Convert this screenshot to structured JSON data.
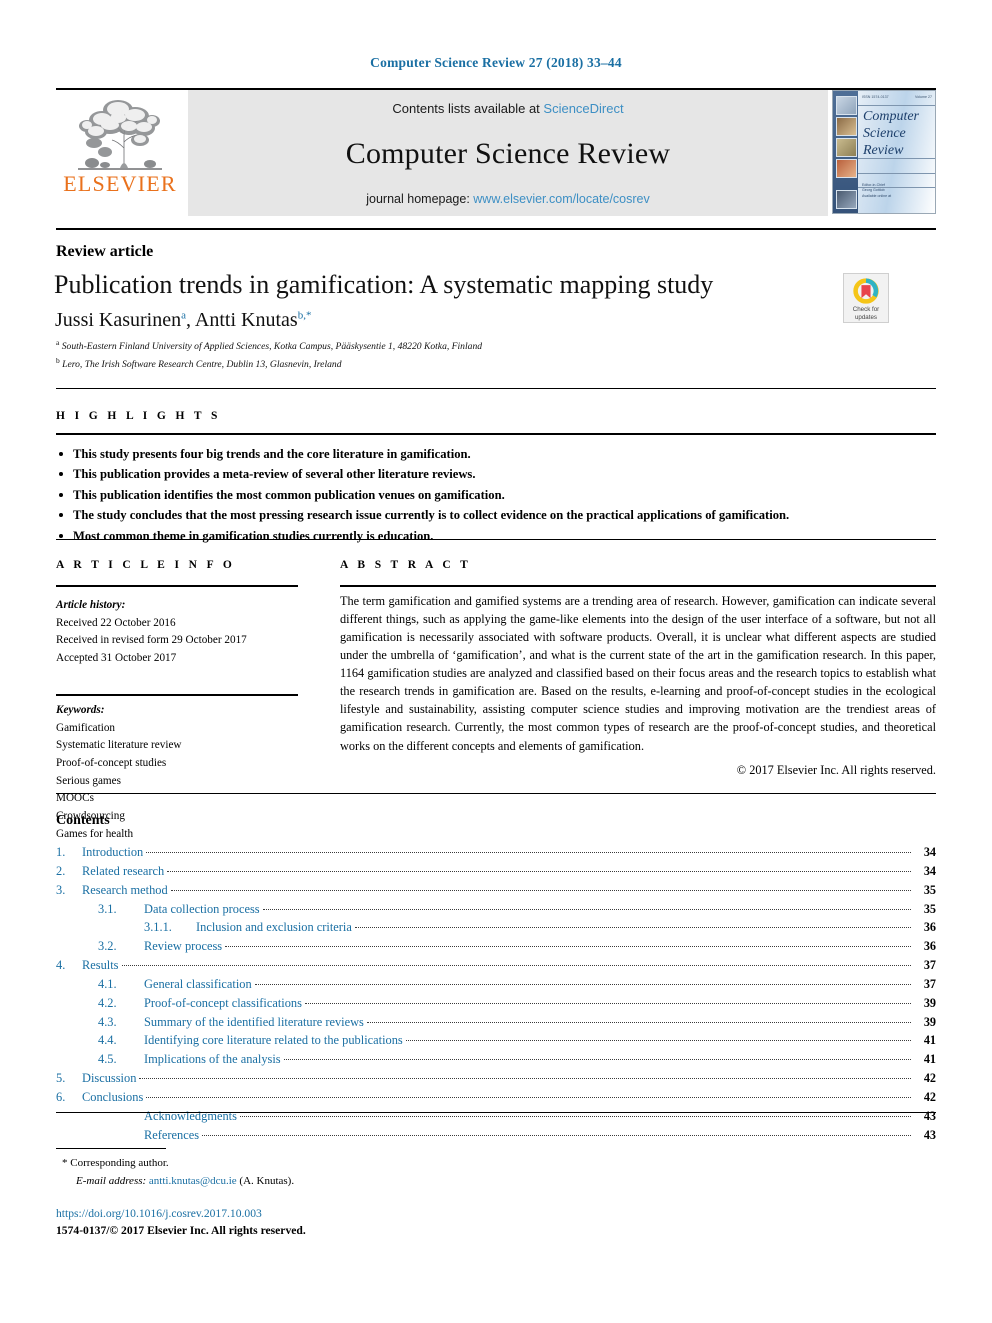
{
  "running_head": "Computer Science Review 27 (2018) 33–44",
  "masthead": {
    "publisher_name": "ELSEVIER",
    "contents_prefix": "Contents lists available at ",
    "contents_link": "ScienceDirect",
    "journal_title": "Computer Science Review",
    "homepage_prefix": "journal homepage: ",
    "homepage_link": "www.elsevier.com/locate/cosrev",
    "cover": {
      "title_line1": "Computer",
      "title_line2": "Science",
      "title_line3": "Review",
      "top_left": "ISSN 1574-0137",
      "top_right": "Volume 27",
      "foot_line1": "Editor-in-Chief",
      "foot_line2": "Georg Gottlob",
      "foot_line3": "Available online at"
    }
  },
  "article": {
    "type": "Review article",
    "title": "Publication trends in gamification: A systematic mapping study",
    "authors": [
      {
        "name": "Jussi Kasurinen",
        "mark": "a"
      },
      {
        "name": "Antti Knutas",
        "mark": "b,"
      }
    ],
    "affiliations": [
      {
        "mark": "a",
        "text": "South-Eastern Finland University of Applied Sciences, Kotka Campus, Pääskysentie 1, 48220 Kotka, Finland"
      },
      {
        "mark": "b",
        "text": "Lero, The Irish Software Research Centre, Dublin 13, Glasnevin, Ireland"
      }
    ],
    "crossmark": {
      "line1": "Check for",
      "line2": "updates"
    }
  },
  "highlights": {
    "label": "H I G H L I G H T S",
    "items": [
      "This study presents four big trends and the core literature in gamification.",
      "This publication provides a meta-review of several other literature reviews.",
      "This publication identifies the most common publication venues on gamification.",
      "The study concludes that the most pressing research issue currently is to collect evidence on the practical applications of gamification.",
      "Most common theme in gamification studies currently is education."
    ]
  },
  "article_info": {
    "label": "A R T I C L E   I N F O",
    "history_head": "Article history:",
    "history": [
      "Received 22 October 2016",
      "Received in revised form 29 October 2017",
      "Accepted 31 October 2017"
    ],
    "keywords_head": "Keywords:",
    "keywords": [
      "Gamification",
      "Systematic literature review",
      "Proof-of-concept studies",
      "Serious games",
      "MOOCs",
      "Crowdsourcing",
      "Games for health"
    ]
  },
  "abstract": {
    "label": "A B S T R A C T",
    "text": "The term gamification and gamified systems are a trending area of research. However, gamification can indicate several different things, such as applying the game-like elements into the design of the user interface of a software, but not all gamification is necessarily associated with software products. Overall, it is unclear what different aspects are studied under the umbrella of ‘gamification’, and what is the current state of the art in the gamification research. In this paper, 1164 gamification studies are analyzed and classified based on their focus areas and the research topics to establish what the research trends in gamification are. Based on the results, e-learning and proof-of-concept studies in the ecological lifestyle and sustainability, assisting computer science studies and improving motivation are the trendiest areas of gamification research. Currently, the most common types of research are the proof-of-concept studies, and theoretical works on the different concepts and elements of gamification.",
    "copyright": "© 2017 Elsevier Inc. All rights reserved."
  },
  "contents": {
    "heading": "Contents",
    "entries": [
      {
        "level": 1,
        "num": "1.",
        "label": "Introduction",
        "page": "34"
      },
      {
        "level": 1,
        "num": "2.",
        "label": "Related research",
        "page": "34"
      },
      {
        "level": 1,
        "num": "3.",
        "label": "Research method",
        "page": "35"
      },
      {
        "level": 2,
        "num": "3.1.",
        "label": "Data collection process",
        "page": "35"
      },
      {
        "level": 3,
        "num": "3.1.1.",
        "label": "Inclusion and exclusion criteria",
        "page": "36"
      },
      {
        "level": 2,
        "num": "3.2.",
        "label": "Review process",
        "page": "36"
      },
      {
        "level": 1,
        "num": "4.",
        "label": "Results",
        "page": "37"
      },
      {
        "level": 2,
        "num": "4.1.",
        "label": "General classification",
        "page": "37"
      },
      {
        "level": 2,
        "num": "4.2.",
        "label": "Proof-of-concept classifications",
        "page": "39"
      },
      {
        "level": 2,
        "num": "4.3.",
        "label": "Summary of the identified literature reviews",
        "page": "39"
      },
      {
        "level": 2,
        "num": "4.4.",
        "label": "Identifying core literature related to the publications",
        "page": "41"
      },
      {
        "level": 2,
        "num": "4.5.",
        "label": "Implications of the analysis",
        "page": "41"
      },
      {
        "level": 1,
        "num": "5.",
        "label": "Discussion",
        "page": "42"
      },
      {
        "level": 1,
        "num": "6.",
        "label": "Conclusions",
        "page": "42"
      },
      {
        "level": 2,
        "num": "",
        "label": "Acknowledgments",
        "page": "43"
      },
      {
        "level": 2,
        "num": "",
        "label": "References",
        "page": "43"
      }
    ]
  },
  "footer": {
    "corresponding_mark": "*",
    "corresponding_text": "Corresponding author.",
    "email_label": "E-mail address:",
    "email": "antti.knutas@dcu.ie",
    "email_suffix": "(A. Knutas).",
    "doi": "https://doi.org/10.1016/j.cosrev.2017.10.003",
    "issn_line": "1574-0137/© 2017 Elsevier Inc. All rights reserved."
  },
  "colors": {
    "link_blue": "#3d8fc4",
    "heading_blue": "#1a6fa3",
    "elsevier_orange": "#E9711C"
  }
}
